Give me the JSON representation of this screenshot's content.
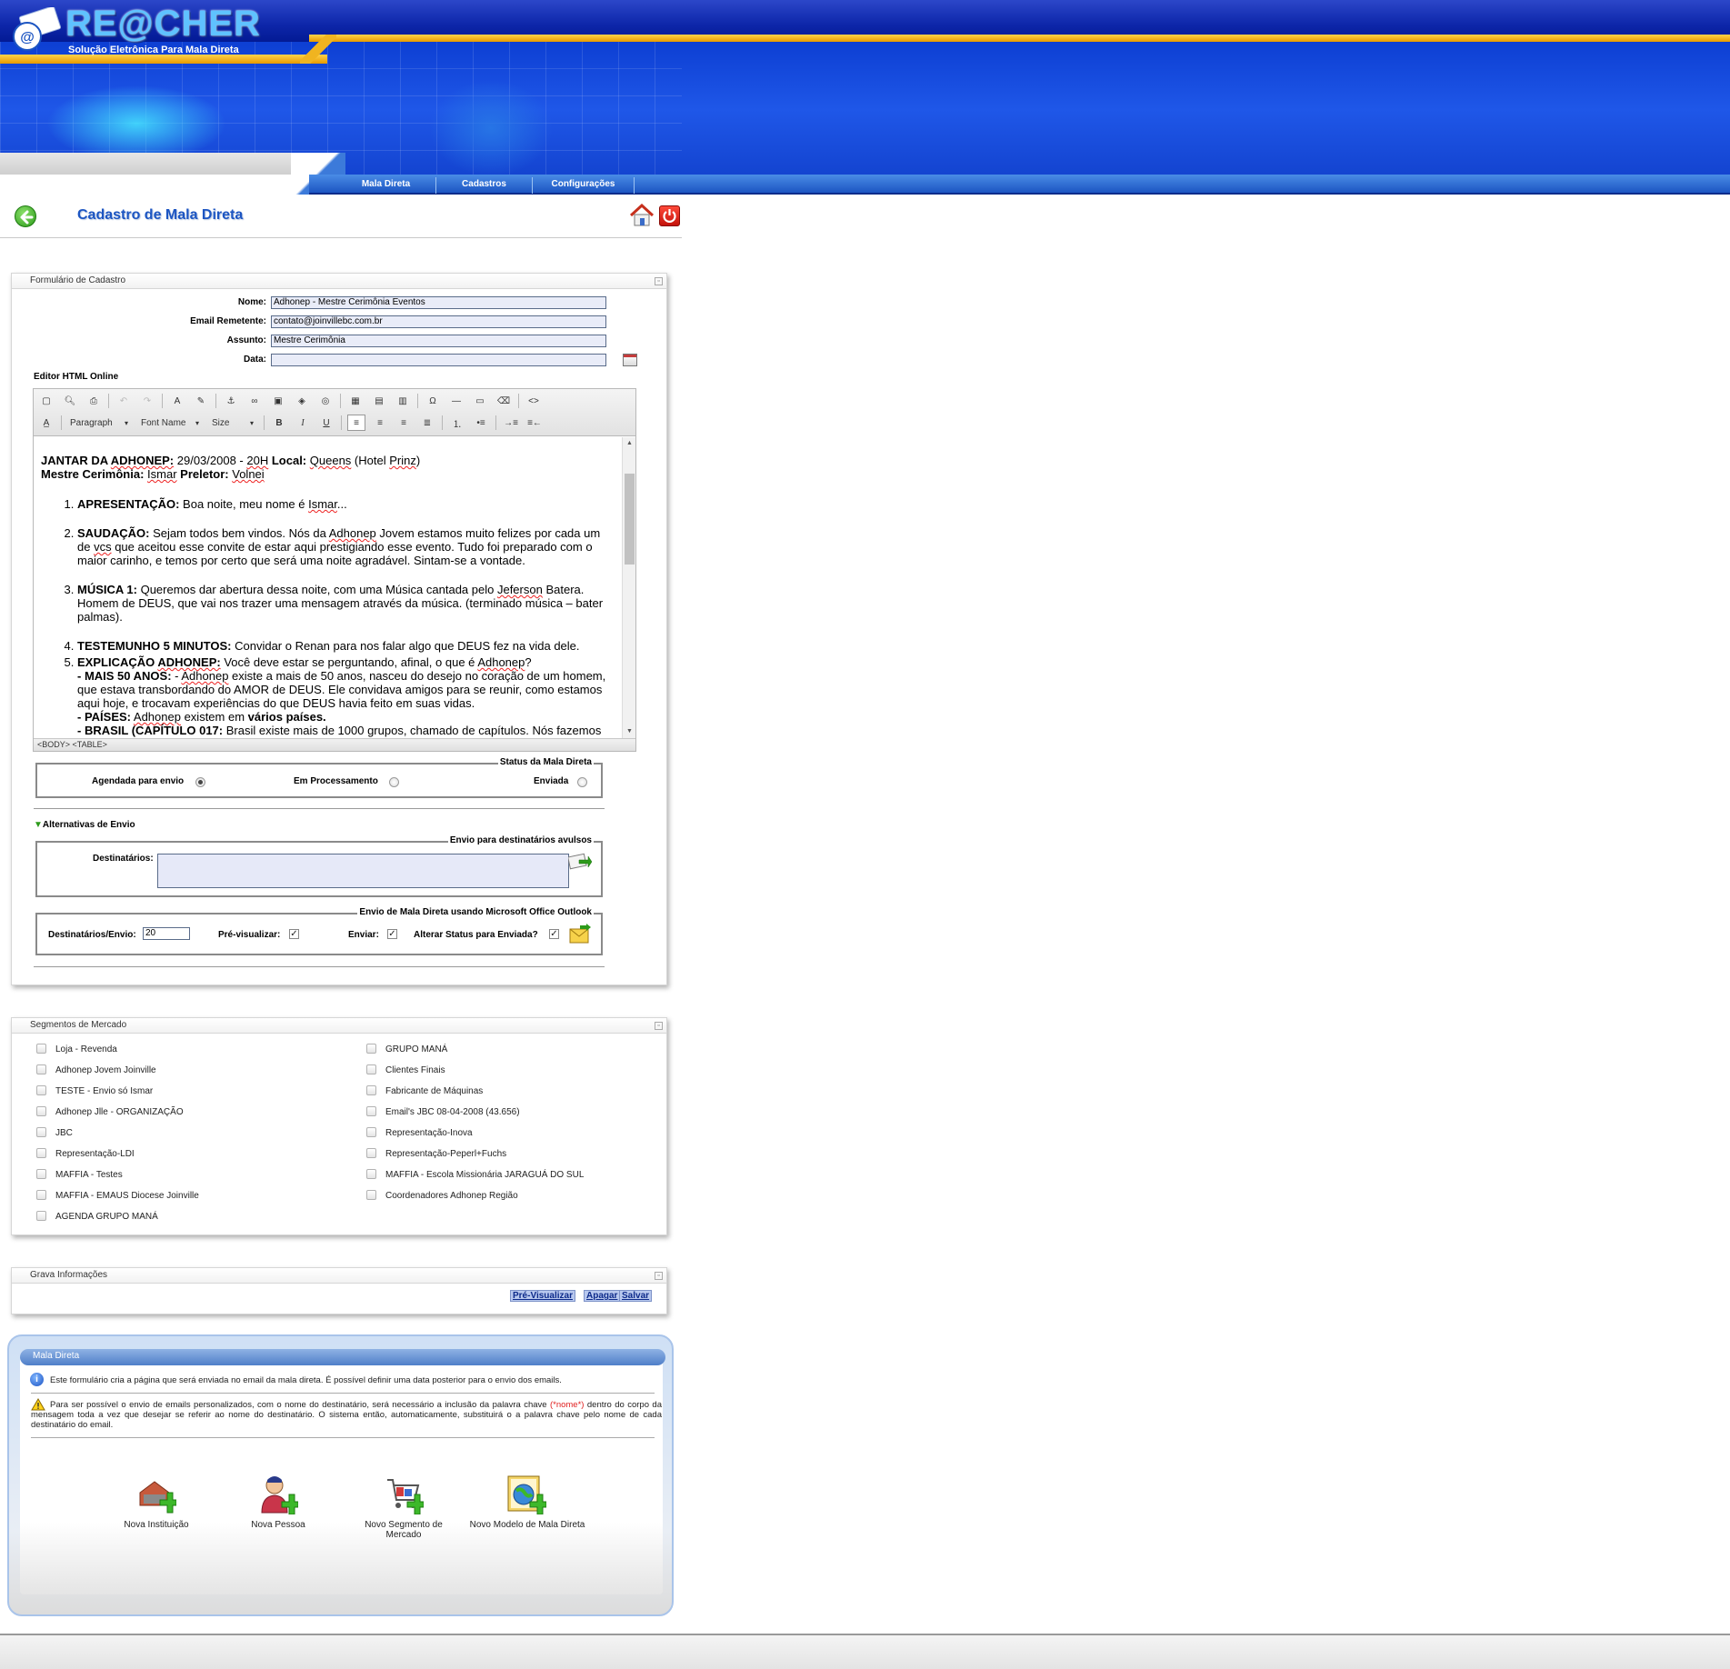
{
  "header": {
    "logo_title": "RE@CHER",
    "logo_subtitle": "Solução Eletrônica Para Mala Direta",
    "nav": [
      "Mala Direta",
      "Cadastros",
      "Configurações"
    ]
  },
  "page": {
    "title": "Cadastro de Mala Direta"
  },
  "form": {
    "panel_title": "Formulário de Cadastro",
    "fields": {
      "nome_label": "Nome:",
      "nome_value": "Adhonep - Mestre Cerimônia Eventos",
      "email_label": "Email Remetente:",
      "email_value": "contato@joinvillebc.com.br",
      "assunto_label": "Assunto:",
      "assunto_value": "Mestre Cerimônia",
      "data_label": "Data:",
      "data_value": ""
    },
    "editor_label": "Editor HTML Online",
    "editor": {
      "paragraph_select": "Paragraph",
      "font_select": "Font Name",
      "size_select": "Size",
      "status_path": "<BODY>  <TABLE>",
      "content": {
        "l1_a": "JANTAR DA ",
        "l1_b": "ADHONEP:",
        "l1_c": " 29/03/2008 - ",
        "l1_d": "20H",
        "l1_e": " Local:",
        "l1_f": " ",
        "l1_g": "Queens",
        "l1_h": " (Hotel ",
        "l1_i": "Prinz",
        "l1_j": ")",
        "l2_a": "Mestre Cerimônia:",
        "l2_b": " ",
        "l2_c": "Ismar",
        "l2_d": " Preletor:",
        "l2_e": " ",
        "l2_f": "Volnei",
        "i1_h": "APRESENTAÇÃO:",
        "i1_t": " Boa noite, meu nome é ",
        "i1_s": "Ismar",
        "i1_e": "...",
        "i2_h": "SAUDAÇÃO:",
        "i2_t1": " Sejam todos bem vindos. Nós da ",
        "i2_s1": "Adhonep",
        "i2_t2": " Jovem estamos muito felizes por cada um de ",
        "i2_s2": "vcs",
        "i2_t3": " que aceitou esse convite de estar aqui prestigiando esse evento. Tudo foi preparado com o maior carinho, e temos por certo que será uma noite agradável. Sintam-se a vontade.",
        "i3_h": "MÚSICA 1:",
        "i3_t1": " Queremos dar abertura dessa noite, com uma Música cantada pelo ",
        "i3_s1": "Jeferson",
        "i3_t2": " Batera. Homem de DEUS, que vai nos trazer uma mensagem através da música. (terminado música – bater palmas).",
        "i4_h": "TESTEMUNHO 5 MINUTOS:",
        "i4_t": " Convidar o Renan para nos falar algo que DEUS fez na vida dele.",
        "i5_h1": "EXPLICAÇÃO ",
        "i5_h2": "ADHONEP:",
        "i5_t1": " Você deve estar se perguntando, afinal, o que é ",
        "i5_s1": "Adhonep",
        "i5_t2": "?",
        "i5_b1": "- MAIS 50 ANOS:",
        "i5_t3": " - ",
        "i5_s2": "Adhonep",
        "i5_t4": " existe a mais de 50 anos, nasceu do desejo no coração de um homem, que estava transbordando do AMOR de DEUS. Ele convidava amigos para se reunir, como estamos aqui hoje, e trocavam experiências do que DEUS havia feito em suas vidas.",
        "i5_b2": "- PAÍSES:",
        "i5_t5": " ",
        "i5_s3": "Adhonep",
        "i5_t6": " existem em ",
        "i5_b3": "vários países.",
        "i5_b4": "- BRASIL (CAPÍTULO 017:",
        "i5_t7": " Brasil existe mais de 1000 grupos, chamado de capítulos. Nós fazemos"
      }
    },
    "status": {
      "legend": "Status da Mala Direta",
      "opt1": "Agendada para envio",
      "opt2": "Em Processamento",
      "opt3": "Enviada",
      "selected": "Agendada para envio"
    },
    "alternatives_label": "Alternativas de Envio",
    "avulsos": {
      "legend": "Envio para destinatários avulsos",
      "label": "Destinatários:",
      "value": ""
    },
    "outlook": {
      "legend": "Envio de Mala Direta usando Microsoft Office Outlook",
      "per_send_label": "Destinatários/Envio:",
      "per_send_value": "20",
      "preview_label": "Pré-visualizar:",
      "send_label": "Enviar:",
      "alter_label": "Alterar Status para Enviada?"
    }
  },
  "segments": {
    "panel_title": "Segmentos de Mercado",
    "left": [
      "Loja - Revenda",
      "Adhonep Jovem Joinville",
      "TESTE - Envio só Ismar",
      "Adhonep Jlle - ORGANIZAÇÃO",
      "JBC",
      "Representação-LDI",
      "MAFFIA - Testes",
      "MAFFIA - EMAUS Diocese Joinville",
      "AGENDA GRUPO MANÁ"
    ],
    "right": [
      "GRUPO MANÁ",
      "Clientes Finais",
      "Fabricante de Máquinas",
      "Email's JBC 08-04-2008 (43.656)",
      "Representação-Inova",
      "Representação-Peperl+Fuchs",
      "MAFFIA - Escola Missionária JARAGUÁ DO SUL",
      "Coordenadores Adhonep Região"
    ]
  },
  "save": {
    "panel_title": "Grava Informações",
    "preview_button": "Pré-Visualizar",
    "delete_button": "Apagar",
    "save_button": "Salvar"
  },
  "info": {
    "title": "Mala Direta",
    "text1": "Este formulário cria a página que será enviada no email da mala direta. É possível definir uma data posterior para o envio dos emails.",
    "text2_a": "Para ser possível o envio de emails personalizados, com o nome do destinatário, será necessário a inclusão da palavra chave ",
    "text2_key": "(*nome*)",
    "text2_b": " dentro do corpo da mensagem toda a vez que desejar se referir ao nome do destinatário. O sistema então, automaticamente, substituirá o a palavra chave pelo nome de cada destinatário do email.",
    "shortcuts": [
      "Nova Instituição",
      "Nova Pessoa",
      "Novo Segmento de Mercado",
      "Novo Modelo de Mala Direta"
    ]
  },
  "colors": {
    "brand_blue": "#1c55c2",
    "header_gold": "#f0b420",
    "keyword_red": "#e02020"
  }
}
